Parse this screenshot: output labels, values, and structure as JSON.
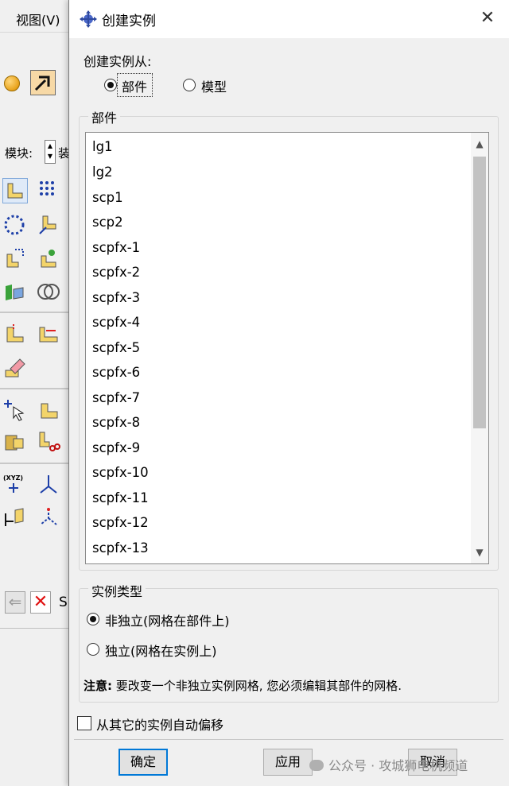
{
  "background_app": {
    "menu_view": "视图(V)",
    "module_label": "模块:",
    "module_value": "装",
    "prompt_text": "S"
  },
  "dialog": {
    "title": "创建实例",
    "close_glyph": "✕",
    "create_from": {
      "label": "创建实例从:",
      "options": [
        {
          "label": "部件",
          "selected": true
        },
        {
          "label": "模型",
          "selected": false
        }
      ]
    },
    "parts": {
      "group_title": "部件",
      "items": [
        "lg1",
        "lg2",
        "scp1",
        "scp2",
        "scpfx-1",
        "scpfx-2",
        "scpfx-3",
        "scpfx-4",
        "scpfx-5",
        "scpfx-6",
        "scpfx-7",
        "scpfx-8",
        "scpfx-9",
        "scpfx-10",
        "scpfx-11",
        "scpfx-12",
        "scpfx-13"
      ]
    },
    "instance_type": {
      "group_title": "实例类型",
      "options": [
        {
          "label": "非独立(网格在部件上)",
          "selected": true
        },
        {
          "label": "独立(网格在实例上)",
          "selected": false
        }
      ],
      "note_bold": "注意:",
      "note_text": " 要改变一个非独立实例网格, 您必须编辑其部件的网格."
    },
    "auto_offset": {
      "label": "从其它的实例自动偏移",
      "checked": false
    },
    "buttons": {
      "ok": "确定",
      "apply": "应用",
      "cancel": "取消"
    }
  },
  "watermark": "公众号 · 攻城狮电机频道",
  "colors": {
    "accent": "#0078d7",
    "dialog_bg": "#f0f0f0",
    "scroll_thumb": "#c2c2c2"
  }
}
